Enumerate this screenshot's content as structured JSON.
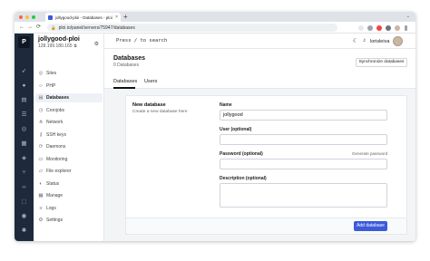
{
  "browser": {
    "tab_title": "jollygood-ploi - Databases - ploi",
    "tab_close": "×",
    "new_tab": "+",
    "url": "ploi.io/panel/servers/75947/databases",
    "nav_back": "←",
    "nav_forward": "→",
    "nav_reload": "⟳"
  },
  "server": {
    "name": "jollygood-ploi",
    "ip": "128.199.180.165"
  },
  "sidebar": {
    "items": [
      {
        "label": "Sites",
        "icon": "globe-icon"
      },
      {
        "label": "PHP",
        "icon": "code-icon"
      },
      {
        "label": "Databases",
        "icon": "database-icon",
        "active": true
      },
      {
        "label": "Cronjobs",
        "icon": "clock-icon"
      },
      {
        "label": "Network",
        "icon": "network-icon"
      },
      {
        "label": "SSH keys",
        "icon": "key-icon"
      },
      {
        "label": "Daemons",
        "icon": "daemon-icon"
      },
      {
        "label": "Monitoring",
        "icon": "monitor-icon"
      },
      {
        "label": "File explorer",
        "icon": "folder-icon"
      },
      {
        "label": "Status",
        "icon": "status-icon"
      },
      {
        "label": "Manage",
        "icon": "manage-icon"
      },
      {
        "label": "Logs",
        "icon": "logs-icon"
      },
      {
        "label": "Settings",
        "icon": "settings-icon"
      }
    ]
  },
  "topbar": {
    "search": "Press / to search",
    "username": "lorisleiva"
  },
  "page": {
    "title": "Databases",
    "subtitle": "0 Databases",
    "sync_button": "Synchronize databases",
    "tabs": [
      "Databases",
      "Users"
    ]
  },
  "form": {
    "title": "New database",
    "description": "Create a new database here",
    "name_label": "Name",
    "name_value": "jollygood",
    "user_label": "User (optional)",
    "password_label": "Password (optional)",
    "generate_password": "Generate password",
    "desc_label": "Description (optional)",
    "submit": "Add database"
  },
  "colors": {
    "accent": "#3b5bdb",
    "rail": "#1e2a3b"
  }
}
